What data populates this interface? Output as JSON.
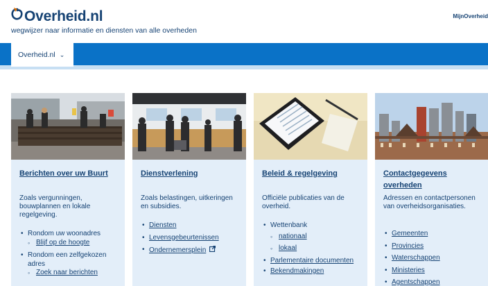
{
  "header": {
    "logo_text": "Overheid.nl",
    "tagline": "wegwijzer naar informatie en diensten van alle overheden",
    "mijn_link": "MijnOverheid"
  },
  "nav": {
    "tab_label": "Overheid.nl",
    "chevron": "⌄"
  },
  "colors": {
    "brand": "#154273",
    "navbar": "#0a72c7",
    "card_bg": "#e3eef9"
  },
  "cards": [
    {
      "title": "Berichten over uw Buurt",
      "desc": "Zoals vergunningen, bouwplannen en lokale regelgeving.",
      "items": [
        {
          "text": "Rondom uw woonadres",
          "link": false
        },
        {
          "text": "Blijf op de hoogte",
          "link": true
        },
        {
          "text": "Rondom een zelfgekozen adres",
          "link": false
        },
        {
          "text": "Zoek naar berichten",
          "link": true
        }
      ]
    },
    {
      "title": "Dienstverlening",
      "desc": "Zoals belastingen, uitkeringen en subsidies.",
      "items": [
        {
          "text": "Diensten",
          "link": true
        },
        {
          "text": "Levensgebeurtenissen",
          "link": true
        },
        {
          "text": "Ondernemersplein",
          "link": true,
          "icon": "external-link-icon"
        }
      ]
    },
    {
      "title": "Beleid & regelgeving",
      "desc": "Officiële publicaties van de overheid.",
      "items": [
        {
          "text": "Wettenbank",
          "link": false
        },
        {
          "text": "nationaal",
          "link": true
        },
        {
          "text": "lokaal",
          "link": true
        },
        {
          "text": "Parlementaire documenten",
          "link": true
        },
        {
          "text": "Bekendmakingen",
          "link": true
        }
      ]
    },
    {
      "title": "Contactgegevens overheden",
      "desc": "Adressen en contactpersonen van overheidsorganisaties.",
      "items": [
        {
          "text": "Gemeenten",
          "link": true
        },
        {
          "text": "Provincies",
          "link": true
        },
        {
          "text": "Waterschappen",
          "link": true
        },
        {
          "text": "Ministeries",
          "link": true
        },
        {
          "text": "Agentschappen",
          "link": true
        }
      ]
    }
  ]
}
